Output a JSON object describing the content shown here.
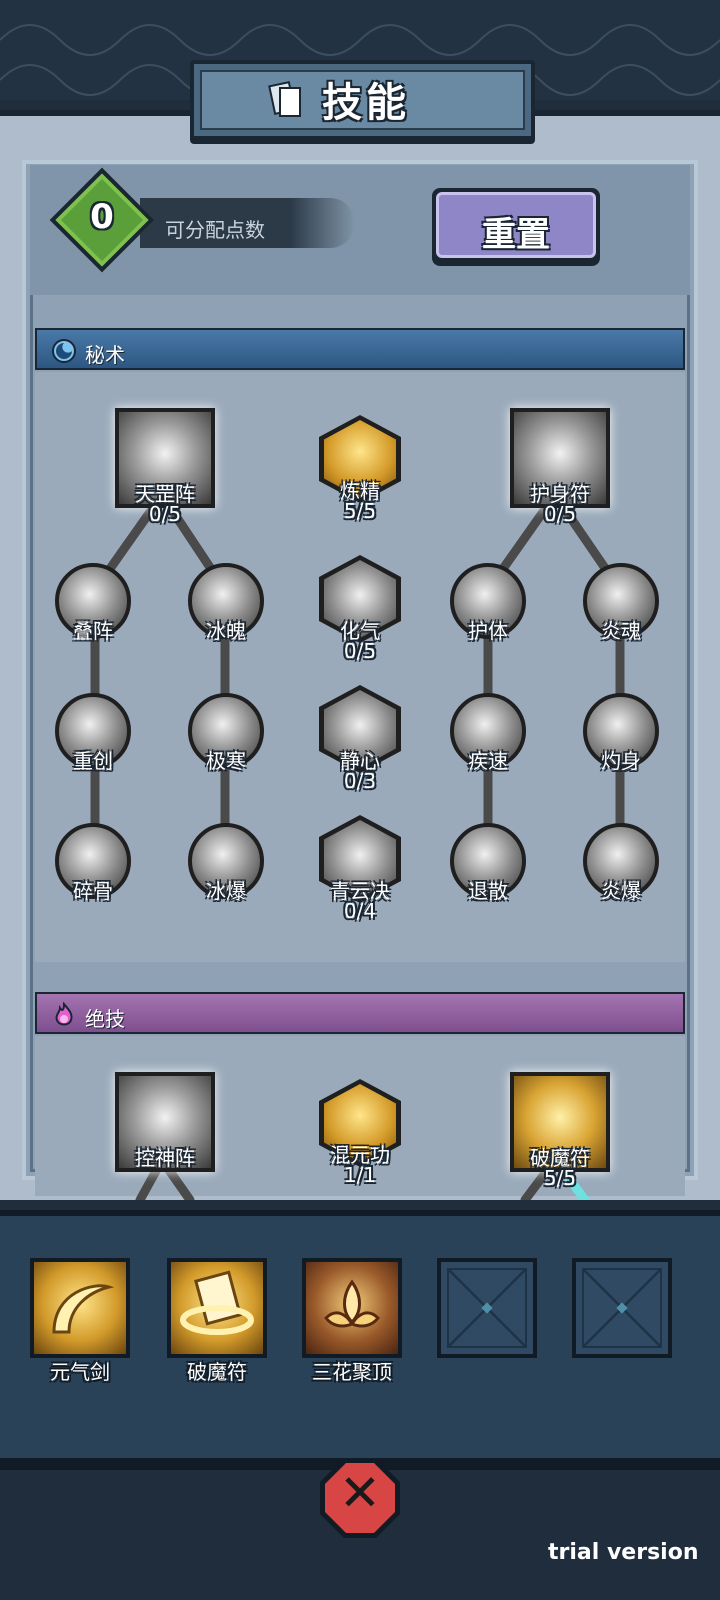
{
  "title": "技能",
  "points": {
    "value": "0",
    "label": "可分配点数"
  },
  "reset_label": "重置",
  "sections": {
    "secret": {
      "label": "秘术",
      "color": "#2d5782"
    },
    "ultimate": {
      "label": "绝技",
      "color": "#7e4f8e"
    }
  },
  "secret_nodes": [
    {
      "name": "天罡阵",
      "level": "0/5",
      "shape": "square",
      "icon": "vortex-icon"
    },
    {
      "name": "炼精",
      "level": "5/5",
      "shape": "hex",
      "icon": "gourd-icon"
    },
    {
      "name": "护身符",
      "level": "0/5",
      "shape": "square",
      "icon": "talisman-icon"
    },
    {
      "name": "叠阵",
      "level": "",
      "shape": "circle",
      "icon": "swirl-icon"
    },
    {
      "name": "冰魄",
      "level": "",
      "shape": "circle",
      "icon": "ice-icon"
    },
    {
      "name": "化气",
      "level": "0/5",
      "shape": "hex",
      "icon": "vase-icon"
    },
    {
      "name": "护体",
      "level": "",
      "shape": "circle",
      "icon": "scroll-icon"
    },
    {
      "name": "炎魂",
      "level": "",
      "shape": "circle",
      "icon": "flame-scroll-icon"
    },
    {
      "name": "重创",
      "level": "",
      "shape": "circle",
      "icon": "strike-icon"
    },
    {
      "name": "极寒",
      "level": "",
      "shape": "circle",
      "icon": "frost-icon"
    },
    {
      "name": "静心",
      "level": "0/3",
      "shape": "hex",
      "icon": "meditate-icon"
    },
    {
      "name": "疾速",
      "level": "",
      "shape": "circle",
      "icon": "speed-icon"
    },
    {
      "name": "灼身",
      "level": "",
      "shape": "circle",
      "icon": "burn-icon"
    },
    {
      "name": "碎骨",
      "level": "",
      "shape": "circle",
      "icon": "shatter-icon"
    },
    {
      "name": "冰爆",
      "level": "",
      "shape": "circle",
      "icon": "ice-burst-icon"
    },
    {
      "name": "青云决",
      "level": "0/4",
      "shape": "hex",
      "icon": "cloud-icon"
    },
    {
      "name": "退散",
      "level": "",
      "shape": "circle",
      "icon": "dispel-icon"
    },
    {
      "name": "炎爆",
      "level": "",
      "shape": "circle",
      "icon": "fire-burst-icon"
    }
  ],
  "ultimate_nodes": [
    {
      "name": "控神阵",
      "level": "",
      "shape": "square",
      "icon": "orb-icon"
    },
    {
      "name": "混元功",
      "level": "1/1",
      "shape": "hex",
      "icon": "gourd-icon"
    },
    {
      "name": "破魔符",
      "level": "5/5",
      "shape": "square",
      "icon": "ring-talisman-icon"
    }
  ],
  "equipped": [
    {
      "label": "元气剑",
      "icon": "sword-arc-icon"
    },
    {
      "label": "破魔符",
      "icon": "ring-talisman-icon"
    },
    {
      "label": "三花聚顶",
      "icon": "lotus-icon"
    },
    {
      "label": "",
      "icon": "empty-slot-icon"
    },
    {
      "label": "",
      "icon": "empty-slot-icon"
    }
  ],
  "watermark": "trial version"
}
